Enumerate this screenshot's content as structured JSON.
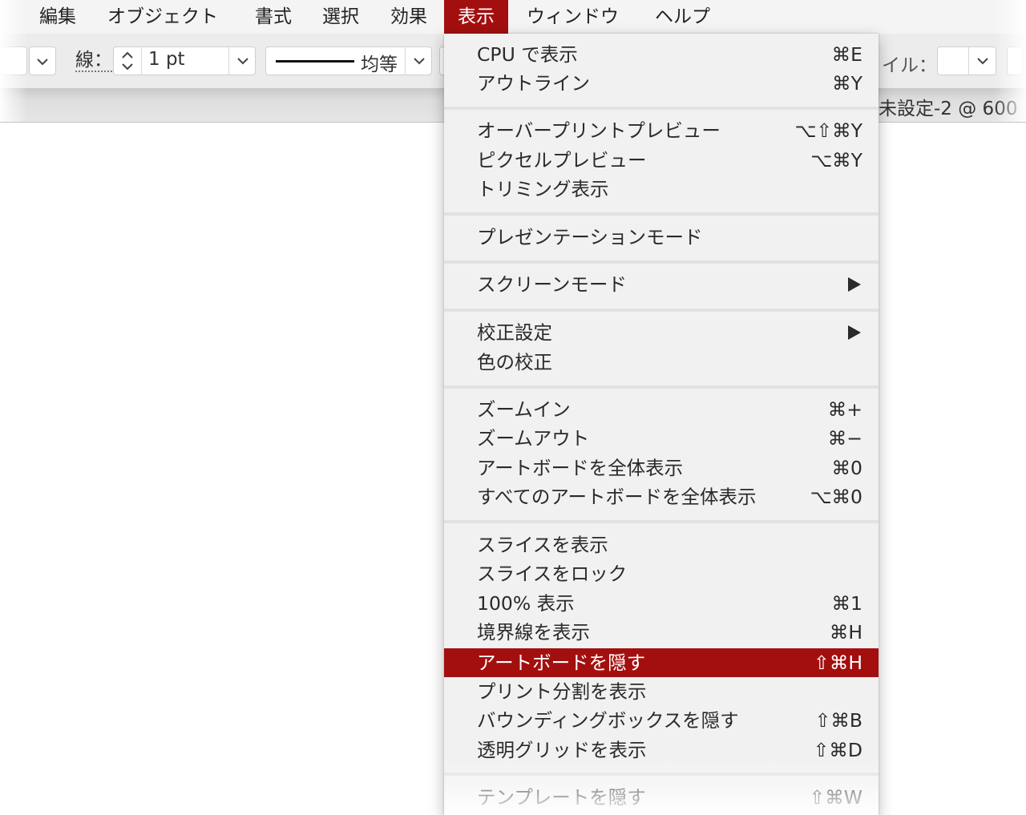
{
  "menubar": {
    "items": [
      {
        "label": "編集"
      },
      {
        "label": "オブジェクト"
      },
      {
        "label": "書式"
      },
      {
        "label": "選択"
      },
      {
        "label": "効果"
      },
      {
        "label": "表示"
      },
      {
        "label": "ウィンドウ"
      },
      {
        "label": "ヘルプ"
      }
    ],
    "active_index": 5,
    "accent_color": "#a30f0f"
  },
  "controlbar": {
    "stroke_label": "線：",
    "stroke_weight": "1 pt",
    "stroke_profile": "均等",
    "style_label": "イル：",
    "icons": [
      "chevron-down-icon",
      "stepper-icon",
      "line-preview-icon"
    ]
  },
  "docbar": {
    "document_title": "未設定-2 @ 600"
  },
  "dropdown": {
    "items": [
      {
        "label": "CPU で表示",
        "shortcut": "⌘E"
      },
      {
        "label": "アウトライン",
        "shortcut": "⌘Y"
      },
      {
        "label": "オーバープリントプレビュー",
        "shortcut": "⌥⇧⌘Y"
      },
      {
        "label": "ピクセルプレビュー",
        "shortcut": "⌥⌘Y"
      },
      {
        "label": "トリミング表示",
        "shortcut": ""
      },
      {
        "label": "プレゼンテーションモード",
        "shortcut": ""
      },
      {
        "label": "スクリーンモード",
        "shortcut": "",
        "submenu": true
      },
      {
        "label": "校正設定",
        "shortcut": "",
        "submenu": true
      },
      {
        "label": "色の校正",
        "shortcut": ""
      },
      {
        "label": "ズームイン",
        "shortcut": "⌘+"
      },
      {
        "label": "ズームアウト",
        "shortcut": "⌘−"
      },
      {
        "label": "アートボードを全体表示",
        "shortcut": "⌘0"
      },
      {
        "label": "すべてのアートボードを全体表示",
        "shortcut": "⌥⌘0"
      },
      {
        "label": "スライスを表示",
        "shortcut": ""
      },
      {
        "label": "スライスをロック",
        "shortcut": ""
      },
      {
        "label": "100% 表示",
        "shortcut": "⌘1"
      },
      {
        "label": "境界線を表示",
        "shortcut": "⌘H"
      },
      {
        "label": "アートボードを隠す",
        "shortcut": "⇧⌘H",
        "highlighted": true
      },
      {
        "label": "プリント分割を表示",
        "shortcut": ""
      },
      {
        "label": "バウンディングボックスを隠す",
        "shortcut": "⇧⌘B"
      },
      {
        "label": "透明グリッドを表示",
        "shortcut": "⇧⌘D"
      },
      {
        "label": "テンプレートを隠す",
        "shortcut": "⇧⌘W"
      }
    ],
    "submenu_icon": "triangle-right-icon"
  }
}
